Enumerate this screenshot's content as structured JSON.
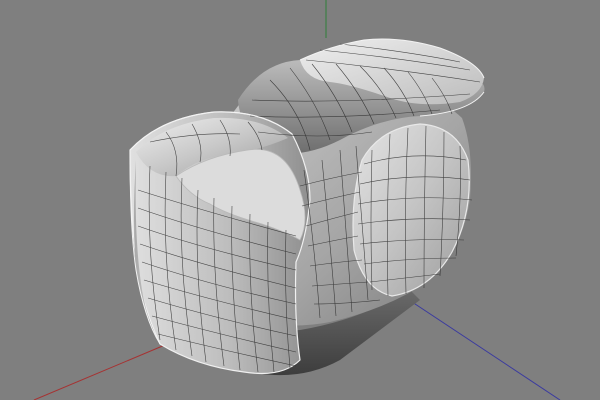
{
  "viewport": {
    "background": "#7f7f7f",
    "axes": {
      "x": {
        "color": "#a63232"
      },
      "y": {
        "color": "#2f7f3a"
      },
      "z": {
        "color": "#3a3aa0"
      }
    },
    "model": {
      "name": "camera-body-polygon-mesh",
      "display_mode": "smooth-shaded-with-wireframe",
      "surface_light": "#d0d0d0",
      "surface_mid": "#a7a7a7",
      "surface_dark": "#5a5a5a",
      "wire_color": "#2b2b2b",
      "edge_highlight": "#f2f2f2"
    }
  }
}
